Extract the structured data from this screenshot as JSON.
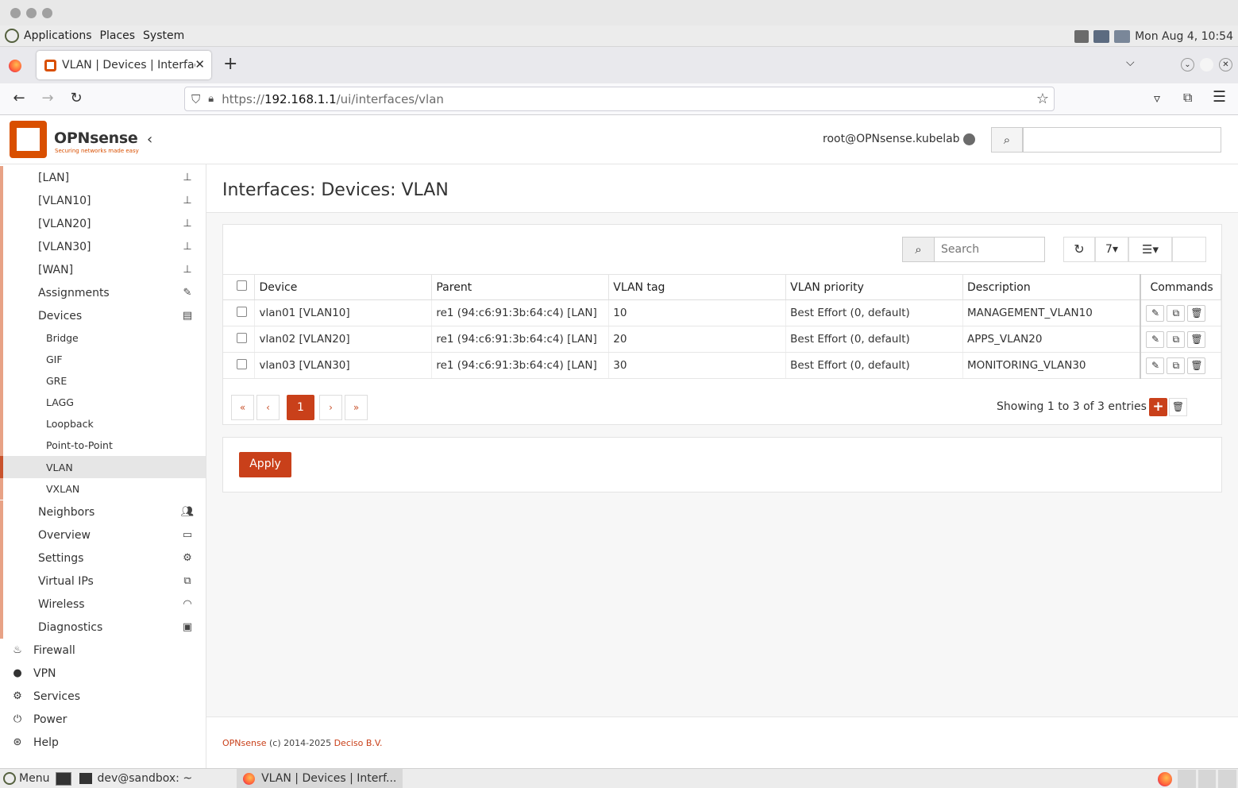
{
  "window": {
    "title": ""
  },
  "desktop_panel": {
    "menus": [
      "Applications",
      "Places",
      "System"
    ],
    "clock": "Mon Aug 4, 10:54"
  },
  "browser": {
    "tab_title": "VLAN | Devices | Interface",
    "new_tab": "+",
    "url_prefix": "https://",
    "url_host": "192.168.1.1",
    "url_path": "/ui/interfaces/vlan"
  },
  "opnsense": {
    "logo_name": "OPNsense",
    "logo_tagline": "Securing networks made easy",
    "user": "root@OPNsense.kubelab",
    "accent": "#d94f00"
  },
  "sidebar": {
    "items": [
      {
        "label": "[LAN]",
        "icon": "sitemap-icon"
      },
      {
        "label": "[VLAN10]",
        "icon": "sitemap-icon"
      },
      {
        "label": "[VLAN20]",
        "icon": "sitemap-icon"
      },
      {
        "label": "[VLAN30]",
        "icon": "sitemap-icon"
      },
      {
        "label": "[WAN]",
        "icon": "sitemap-icon"
      },
      {
        "label": "Assignments",
        "icon": "pencil-icon"
      },
      {
        "label": "Devices",
        "icon": "archive-icon"
      },
      {
        "label": "Bridge"
      },
      {
        "label": "GIF"
      },
      {
        "label": "GRE"
      },
      {
        "label": "LAGG"
      },
      {
        "label": "Loopback"
      },
      {
        "label": "Point-to-Point"
      },
      {
        "label": "VLAN"
      },
      {
        "label": "VXLAN"
      },
      {
        "label": "Neighbors",
        "icon": "users-icon"
      },
      {
        "label": "Overview",
        "icon": "server-icon"
      },
      {
        "label": "Settings",
        "icon": "cogs-icon"
      },
      {
        "label": "Virtual IPs",
        "icon": "clone-icon"
      },
      {
        "label": "Wireless",
        "icon": "wifi-icon"
      },
      {
        "label": "Diagnostics",
        "icon": "medkit-icon"
      },
      {
        "label": "Firewall",
        "icon": "fire-icon"
      },
      {
        "label": "VPN",
        "icon": "globe-icon"
      },
      {
        "label": "Services",
        "icon": "cog-icon"
      },
      {
        "label": "Power",
        "icon": "plug-icon"
      },
      {
        "label": "Help",
        "icon": "life-ring-icon"
      }
    ]
  },
  "page": {
    "title": "Interfaces: Devices: VLAN",
    "search_placeholder": "Search",
    "page_size": "7",
    "columns": [
      "Device",
      "Parent",
      "VLAN tag",
      "VLAN priority",
      "Description",
      "Commands"
    ],
    "rows": [
      {
        "device": "vlan01 [VLAN10]",
        "parent": "re1 (94:c6:91:3b:64:c4) [LAN]",
        "tag": "10",
        "priority": "Best Effort (0, default)",
        "description": "MANAGEMENT_VLAN10"
      },
      {
        "device": "vlan02 [VLAN20]",
        "parent": "re1 (94:c6:91:3b:64:c4) [LAN]",
        "tag": "20",
        "priority": "Best Effort (0, default)",
        "description": "APPS_VLAN20"
      },
      {
        "device": "vlan03 [VLAN30]",
        "parent": "re1 (94:c6:91:3b:64:c4) [LAN]",
        "tag": "30",
        "priority": "Best Effort (0, default)",
        "description": "MONITORING_VLAN30"
      }
    ],
    "pagination": {
      "first": "«",
      "prev": "‹",
      "current": "1",
      "next": "›",
      "last": "»"
    },
    "showing": "Showing 1 to 3 of 3 entries",
    "apply_label": "Apply"
  },
  "footer": {
    "brand": "OPNsense",
    "copyright": " (c) 2014-2025 ",
    "company": "Deciso B.V."
  },
  "taskbar": {
    "menu_label": "Menu",
    "terminal_label": "dev@sandbox: ~",
    "browser_label": "VLAN | Devices | Interf..."
  }
}
